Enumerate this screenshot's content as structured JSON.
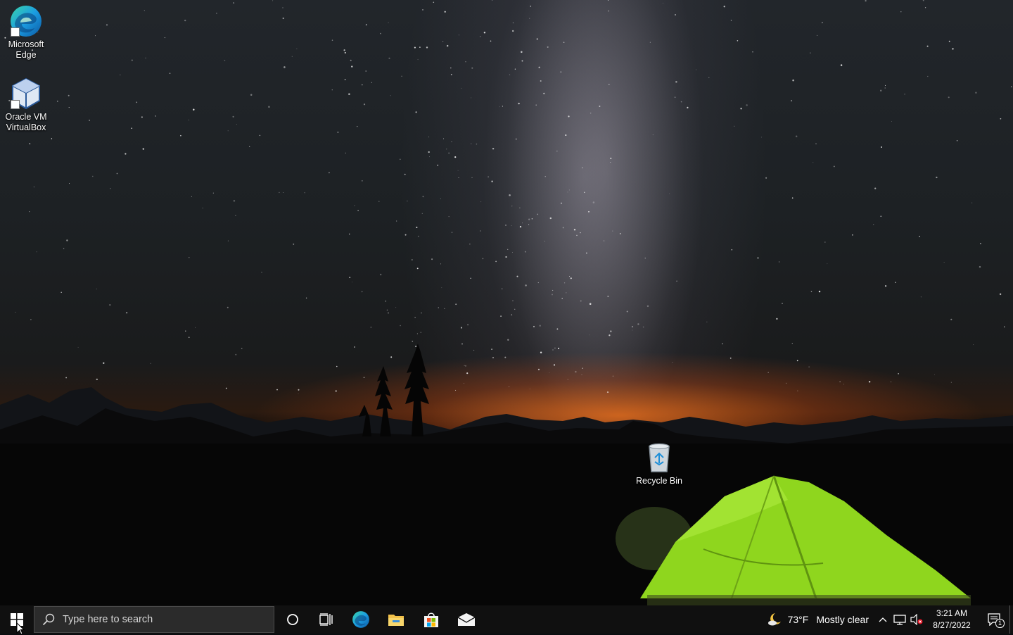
{
  "desktop": {
    "icons": [
      {
        "label_line1": "Microsoft",
        "label_line2": "Edge",
        "icon": "edge-icon"
      },
      {
        "label_line1": "Oracle VM",
        "label_line2": "VirtualBox",
        "icon": "virtualbox-icon"
      },
      {
        "label_line1": "Recycle Bin",
        "label_line2": "",
        "icon": "recycle-bin-icon"
      }
    ]
  },
  "taskbar": {
    "start_icon": "windows-logo-icon",
    "search_placeholder": "Type here to search",
    "pinned": [
      {
        "name": "cortana",
        "icon": "cortana-circle-icon"
      },
      {
        "name": "task-view",
        "icon": "task-view-icon"
      },
      {
        "name": "edge",
        "icon": "edge-icon"
      },
      {
        "name": "file-explorer",
        "icon": "folder-icon"
      },
      {
        "name": "store",
        "icon": "store-bag-icon"
      },
      {
        "name": "mail",
        "icon": "mail-icon"
      }
    ],
    "weather": {
      "temp": "73°F",
      "condition": "Mostly clear",
      "icon": "moon-cloud-icon"
    },
    "tray_icons": [
      "chevron-up-icon",
      "network-icon",
      "volume-muted-icon"
    ],
    "clock": {
      "time": "3:21 AM",
      "date": "8/27/2022"
    },
    "notifications": {
      "count": "1",
      "icon": "action-center-icon"
    }
  },
  "colors": {
    "taskbar_bg": "#101010",
    "search_bg": "#2b2b2b",
    "tent_green": "#8fd61e",
    "horizon_orange": "#ff7a1e"
  }
}
